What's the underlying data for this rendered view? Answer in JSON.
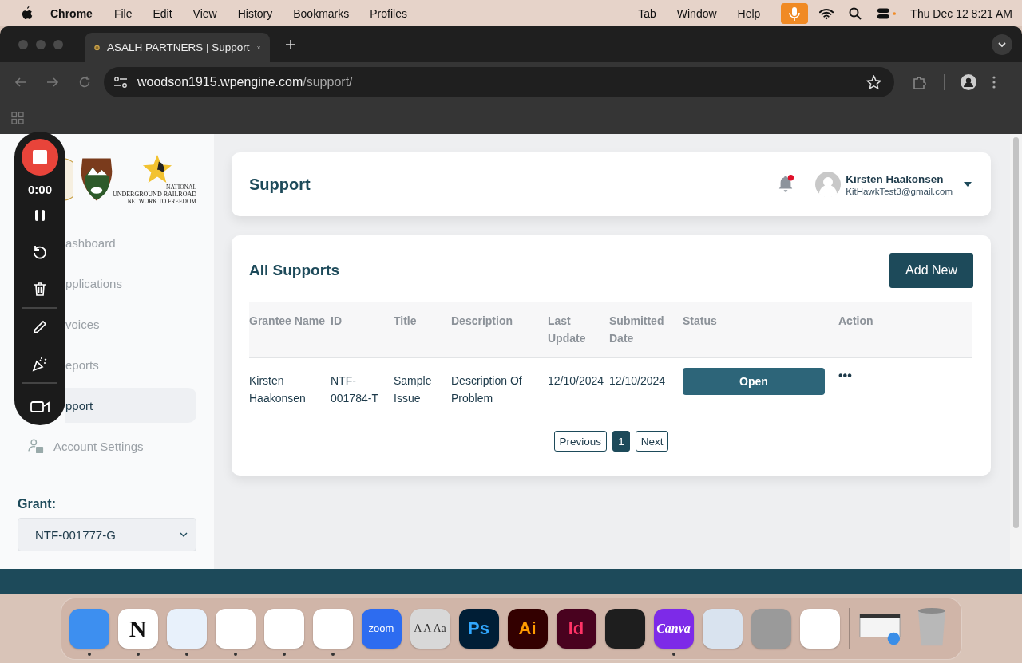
{
  "menu_bar": {
    "app": "Chrome",
    "menus": [
      "File",
      "Edit",
      "View",
      "History",
      "Bookmarks",
      "Profiles"
    ],
    "right_menus": [
      "Tab",
      "Window",
      "Help"
    ],
    "clock": "Thu Dec 12  8:21 AM"
  },
  "browser": {
    "tab": {
      "title": "ASALH PARTNERS | Support"
    },
    "address": {
      "host": "woodson1915.wpengine.com",
      "path": "/support/"
    }
  },
  "recorder": {
    "time": "0:00"
  },
  "sidebar": {
    "logo_text": [
      "NATIONAL",
      "UNDERGROUND RAILROAD",
      "NETWORK TO FREEDOM"
    ],
    "nav": [
      {
        "label": "ashboard",
        "kind": "covered",
        "selected": false
      },
      {
        "label": "pplications",
        "kind": "covered",
        "selected": false
      },
      {
        "label": "voices",
        "kind": "covered",
        "selected": false
      },
      {
        "label": "eports",
        "kind": "covered",
        "selected": false
      },
      {
        "label": "pport",
        "kind": "covered",
        "selected": true
      },
      {
        "label": "Account Settings",
        "kind": "icon",
        "selected": false
      }
    ],
    "grant": {
      "label": "Grant:",
      "value": "NTF-001777-G"
    }
  },
  "header": {
    "title": "Support",
    "notification": true,
    "user": {
      "name": "Kirsten Haakonsen",
      "email": "KitHawkTest3@gmail.com"
    }
  },
  "supports": {
    "title": "All Supports",
    "add_button": "Add New",
    "columns": [
      "Grantee Name",
      "ID",
      "Title",
      "Description",
      "Last Update",
      "Submitted Date",
      "Status",
      "Action"
    ],
    "rows": [
      {
        "cells": [
          "Kirsten Haakonsen",
          "NTF-001784-T",
          "Sample Issue",
          "Description Of Problem",
          "12/10/2024",
          "12/10/2024"
        ],
        "status": "Open",
        "action": "•••"
      }
    ],
    "pagination": [
      {
        "label": "Previous",
        "selected": false
      },
      {
        "label": "1",
        "selected": true
      },
      {
        "label": "Next",
        "selected": false
      }
    ]
  },
  "dock": [
    {
      "color": "#3d8ff0",
      "running": true
    },
    {
      "label": "N",
      "color": "#ffffff",
      "running": true
    },
    {
      "color": "#e8f1fb",
      "running": true
    },
    {
      "color": "#ffffff",
      "running": true
    },
    {
      "color": "#ffffff",
      "running": true
    },
    {
      "color": "#ffffff",
      "running": true
    },
    {
      "label": "zoom",
      "color": "#2d6cf0",
      "running": false
    },
    {
      "label": "A A Aa",
      "color": "#d8d8d8",
      "running": false
    },
    {
      "label": "Ps",
      "color": "#001e36",
      "running": false
    },
    {
      "label": "Ai",
      "color": "#330000",
      "running": false
    },
    {
      "label": "Id",
      "color": "#49021f",
      "running": false
    },
    {
      "color": "#1e1e1e",
      "running": false
    },
    {
      "label": "Canva",
      "color": "#7d2ae8",
      "running": true
    },
    {
      "color": "#d9e3ef",
      "running": false
    },
    {
      "color": "#9a9a9a",
      "running": false
    },
    {
      "color": "#ffffff",
      "running": false
    }
  ]
}
